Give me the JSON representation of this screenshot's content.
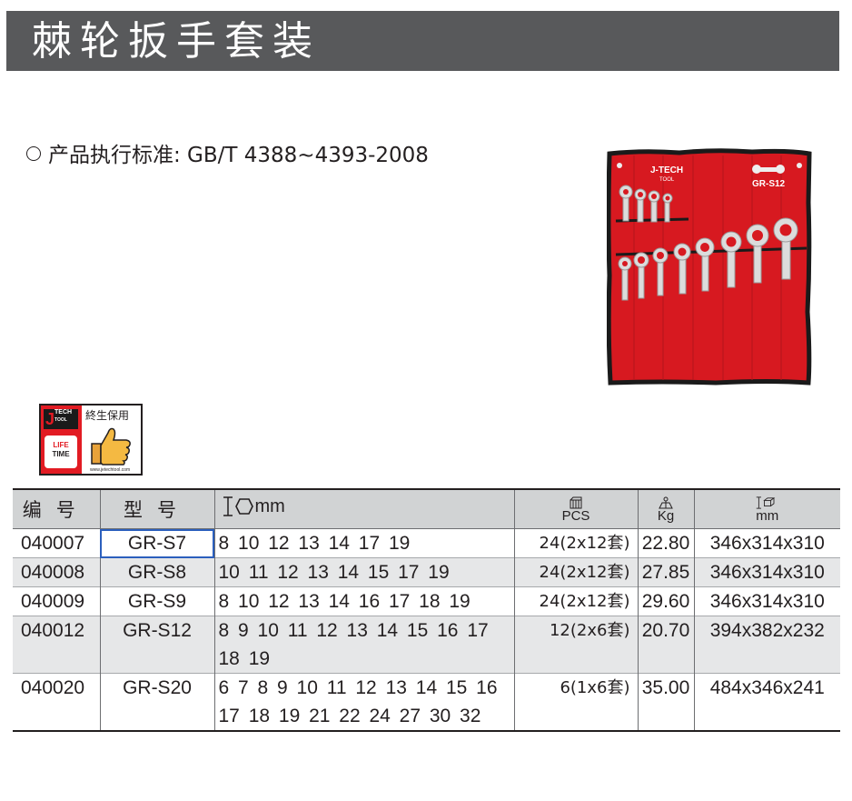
{
  "title": "棘轮扳手套装",
  "standard": "产品执行标准: GB/T 4388~4393-2008",
  "photo": {
    "brand": "J-TECH",
    "brand_sub": "TOOL",
    "model_label": "GR-S12"
  },
  "badge": {
    "text": "終生保用",
    "brand": "TECH",
    "brand_sub": "TOOL",
    "life_line1": "LIFE",
    "life_line2": "TIME",
    "url": "www.jetechtool.com"
  },
  "table": {
    "headers": {
      "code": "编号",
      "model": "型号",
      "size_unit": "mm",
      "pcs": "PCS",
      "kg": "Kg",
      "dim_unit": "mm"
    },
    "rows": [
      {
        "code": "040007",
        "model": "GR-S7",
        "sizes": "8 10 12 13 14 17 19",
        "pcs": "24(2x12套)",
        "kg": "22.80",
        "dim": "346x314x310"
      },
      {
        "code": "040008",
        "model": "GR-S8",
        "sizes": "10 11 12 13 14 15 17 19",
        "pcs": "24(2x12套)",
        "kg": "27.85",
        "dim": "346x314x310"
      },
      {
        "code": "040009",
        "model": "GR-S9",
        "sizes": "8 10 12 13 14 16 17 18 19",
        "pcs": "24(2x12套)",
        "kg": "29.60",
        "dim": "346x314x310"
      },
      {
        "code": "040012",
        "model": "GR-S12",
        "sizes": "8 9 10 11 12 13 14 15 16 17 18 19",
        "pcs": "12(2x6套)",
        "kg": "20.70",
        "dim": "394x382x232"
      },
      {
        "code": "040020",
        "model": "GR-S20",
        "sizes": "6 7 8 9 10 11 12 13 14 15 16 17 18 19 21 22 24 27 30 32",
        "pcs": "6(1x6套)",
        "kg": "35.00",
        "dim": "484x346x241"
      }
    ]
  },
  "colors": {
    "title_bar": "#58595b",
    "header_bg": "#d1d3d4",
    "row_shade": "#e6e7e8",
    "pouch_red": "#e21b23",
    "selection": "#2b5fbd"
  }
}
